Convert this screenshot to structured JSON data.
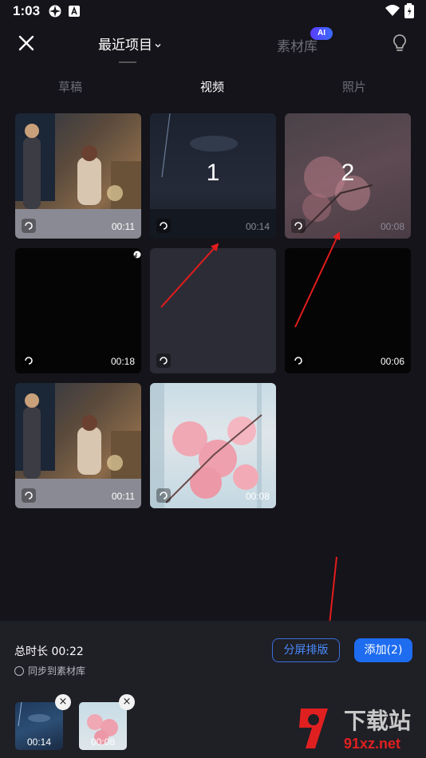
{
  "status_bar": {
    "time": "1:03"
  },
  "nav": {
    "recent_label": "最近项目",
    "library_label": "素材库",
    "ai_badge": "AI"
  },
  "tabs": [
    {
      "label": "草稿"
    },
    {
      "label": "视频"
    },
    {
      "label": "照片"
    }
  ],
  "media": [
    {
      "duration": "00:11",
      "number": ""
    },
    {
      "duration": "00:14",
      "number": "1"
    },
    {
      "duration": "00:08",
      "number": "2"
    },
    {
      "duration": "00:18",
      "number": ""
    },
    {
      "duration": "",
      "number": ""
    },
    {
      "duration": "00:06",
      "number": ""
    },
    {
      "duration": "00:11",
      "number": ""
    },
    {
      "duration": "00:08",
      "number": ""
    }
  ],
  "bottom": {
    "total_label": "总时长 00:22",
    "sync_label": "同步到素材库",
    "split_label": "分屏排版",
    "add_label": "添加(2)",
    "selected": [
      {
        "duration": "00:14",
        "remove": "×"
      },
      {
        "duration": "00:08",
        "remove": "×"
      }
    ]
  },
  "watermark": {
    "brand": "下载站",
    "url": "91xz.net"
  },
  "colors": {
    "accent": "#1e6cf0",
    "arrow": "#e21c1c",
    "background": "#14141a"
  }
}
